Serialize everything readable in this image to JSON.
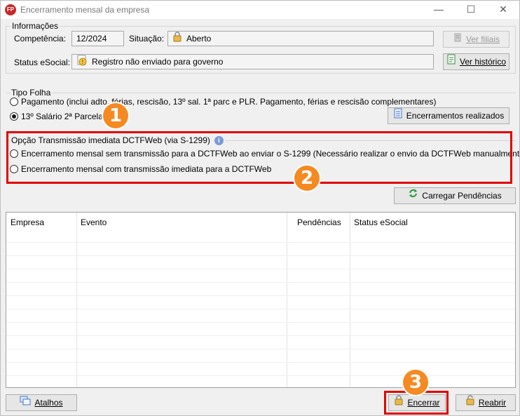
{
  "window": {
    "title": "Encerramento mensal da empresa",
    "icon_label": "FP",
    "controls": {
      "minimize": "—",
      "maximize": "☐",
      "close": "✕"
    }
  },
  "informacoes": {
    "group_title": "Informações",
    "competencia_label": "Competência:",
    "competencia_value": "12/2024",
    "situacao_label": "Situação:",
    "situacao_value": "Aberto",
    "ver_filiais": "Ver filiais",
    "status_esocial_label": "Status eSocial:",
    "status_esocial_value": "Registro não enviado para governo",
    "ver_historico": "Ver histórico"
  },
  "tipo_folha": {
    "group_title": "Tipo Folha",
    "options": [
      {
        "label": "Pagamento (inclui adto, férias, rescisão, 13º sal. 1ª parc e PLR. Pagamento, férias e rescisão complementares)",
        "checked": false
      },
      {
        "label": "13º Salário 2ª Parcela",
        "checked": true
      }
    ],
    "encerramentos_realizados": "Encerramentos realizados"
  },
  "transmissao": {
    "group_title": "Opção Transmissão imediata DCTFWeb (via S-1299)",
    "options": [
      {
        "label": "Encerramento mensal sem transmissão para a DCTFWeb ao enviar o S-1299 (Necessário realizar o envio da DCTFWeb manualmente)",
        "checked": false
      },
      {
        "label": "Encerramento mensal com transmissão imediata para a DCTFWeb",
        "checked": false
      }
    ]
  },
  "carregar_pendencias": "Carregar Pendências",
  "table": {
    "columns": [
      "Empresa",
      "Evento",
      "Pendências",
      "Status eSocial"
    ],
    "rows": []
  },
  "footer": {
    "atalhos": "Atalhos",
    "encerrar": "Encerrar",
    "reabrir": "Reabrir"
  },
  "annotations": {
    "badge_1": "1",
    "badge_2": "2",
    "badge_3": "3",
    "highlight_color": "#e00000",
    "badge_color": "#f58a22"
  }
}
